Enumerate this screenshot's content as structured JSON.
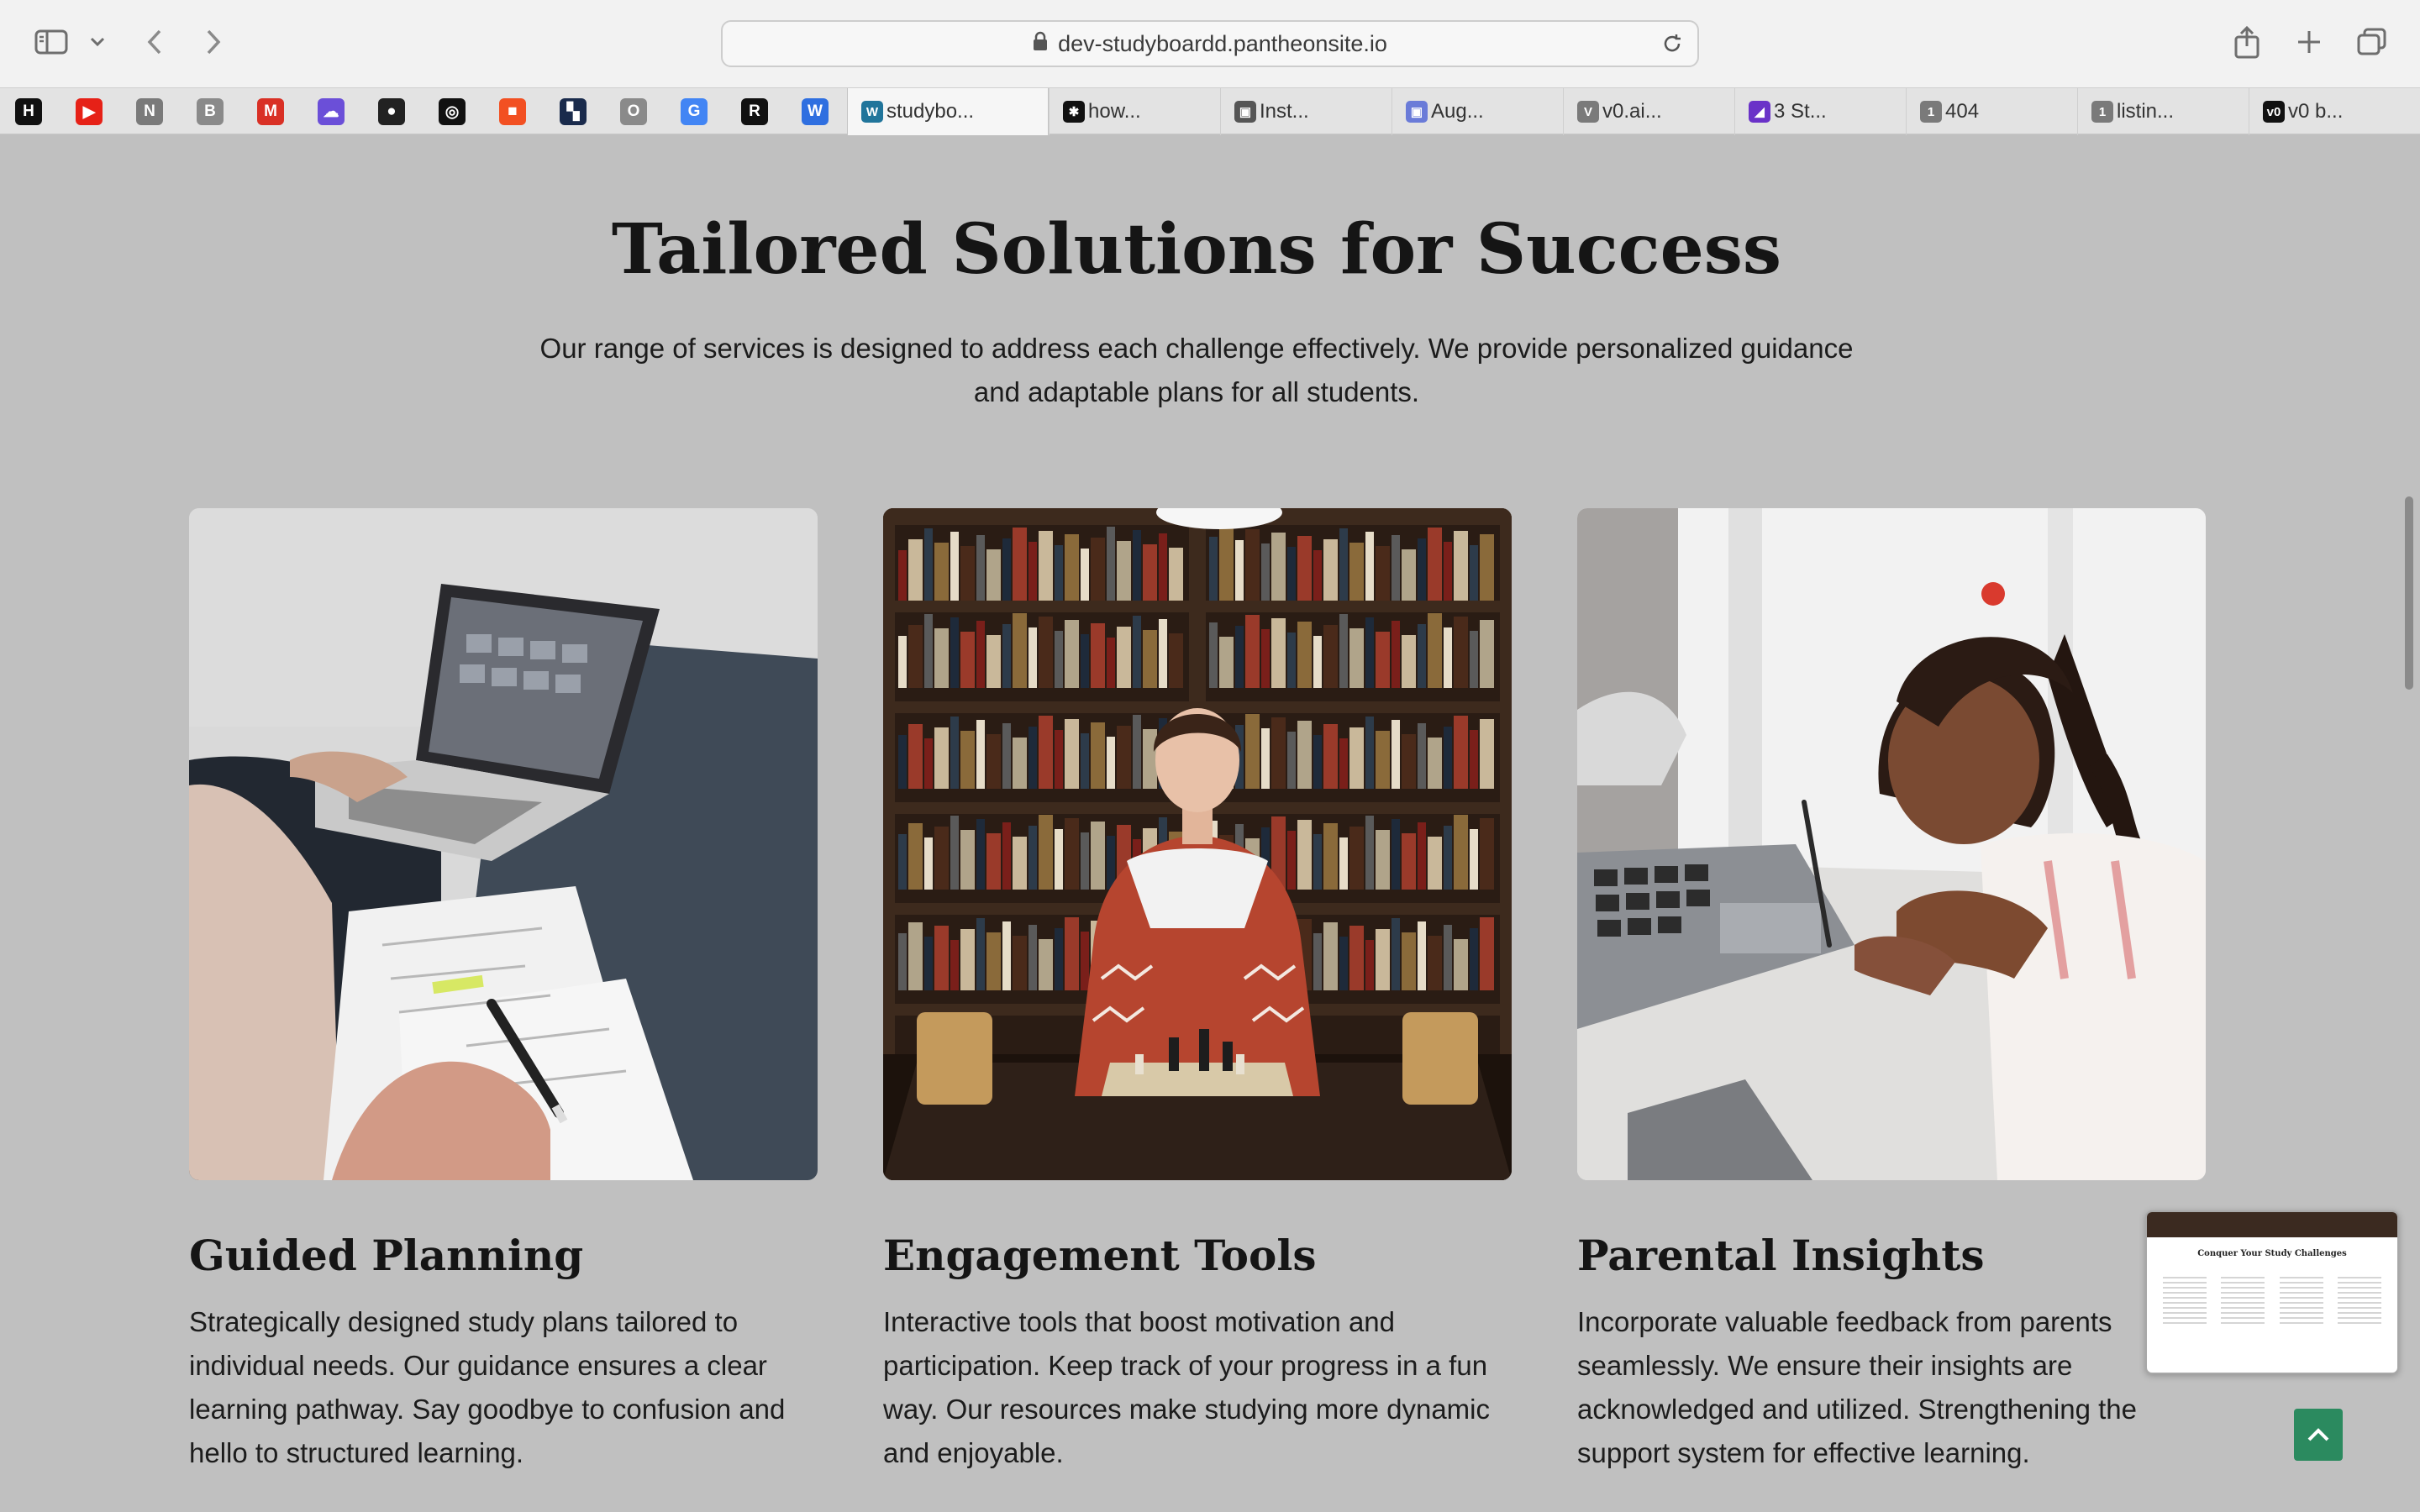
{
  "browser": {
    "url": "dev-studyboardd.pantheonsite.io",
    "pinned": [
      {
        "icon": "hn-icon",
        "glyph": "H",
        "color": "#111111"
      },
      {
        "icon": "youtube-icon",
        "glyph": "▶",
        "color": "#e62117"
      },
      {
        "icon": "notion-icon",
        "glyph": "N",
        "color": "#7a7a7a"
      },
      {
        "icon": "b-icon",
        "glyph": "B",
        "color": "#8a8a8a"
      },
      {
        "icon": "gmail-icon",
        "glyph": "M",
        "color": "#d93025"
      },
      {
        "icon": "cloud-icon",
        "glyph": "☁",
        "color": "#6b4fd8"
      },
      {
        "icon": "github-icon",
        "glyph": "●",
        "color": "#222222"
      },
      {
        "icon": "openai-icon",
        "glyph": "◎",
        "color": "#111111"
      },
      {
        "icon": "microsoft-icon",
        "glyph": "■",
        "color": "#f25022"
      },
      {
        "icon": "bitwarden-icon",
        "glyph": "▚",
        "color": "#1a2b4c"
      },
      {
        "icon": "o-icon",
        "glyph": "O",
        "color": "#8a8a8a"
      },
      {
        "icon": "google-icon",
        "glyph": "G",
        "color": "#4285f4"
      },
      {
        "icon": "readwise-icon",
        "glyph": "R",
        "color": "#111111"
      },
      {
        "icon": "w-icon",
        "glyph": "W",
        "color": "#2f6fe0"
      }
    ],
    "tabs": [
      {
        "label": "studybo...",
        "icon": "wordpress-icon",
        "glyph": "W",
        "color": "#21759b",
        "active": true
      },
      {
        "label": "how...",
        "icon": "perplexity-icon",
        "glyph": "✱",
        "color": "#111111",
        "active": false
      },
      {
        "label": "Inst...",
        "icon": "screenshot-icon",
        "glyph": "▣",
        "color": "#555555",
        "active": false
      },
      {
        "label": "Aug...",
        "icon": "ai-icon",
        "glyph": "▣",
        "color": "#6a7bd8",
        "active": false
      },
      {
        "label": "v0.ai...",
        "icon": "v-icon",
        "glyph": "V",
        "color": "#7a7a7a",
        "active": false
      },
      {
        "label": "3 St...",
        "icon": "linear-icon",
        "glyph": "◢",
        "color": "#6a32c8",
        "active": false
      },
      {
        "label": "404",
        "icon": "1password-icon",
        "glyph": "1",
        "color": "#7a7a7a",
        "active": false
      },
      {
        "label": "listin...",
        "icon": "1password-icon",
        "glyph": "1",
        "color": "#7a7a7a",
        "active": false
      },
      {
        "label": "v0 b...",
        "icon": "v0-icon",
        "glyph": "v0",
        "color": "#111111",
        "active": false
      }
    ]
  },
  "section": {
    "title": "Tailored Solutions for Success",
    "intro_line1": "Our range of services is designed to address each challenge effectively. We provide personalized guidance",
    "intro_line2": "and adaptable plans for all students."
  },
  "cards": [
    {
      "title": "Guided Planning",
      "text": "Strategically designed study plans tailored to individual needs. Our guidance ensures a clear learning pathway. Say goodbye to confusion and hello to structured learning."
    },
    {
      "title": "Engagement Tools",
      "text": "Interactive tools that boost motivation and participation. Keep track of your progress in a fun way. Our resources make studying more dynamic and enjoyable."
    },
    {
      "title": "Parental Insights",
      "text": "Incorporate valuable feedback from parents seamlessly. We ensure their insights are acknowledged and utilized. Strengthening the support system for effective learning."
    }
  ],
  "preview": {
    "title": "Conquer Your Study Challenges"
  },
  "colors": {
    "page_bg": "#c0c0c0",
    "accent_button": "#2b8a5f"
  }
}
